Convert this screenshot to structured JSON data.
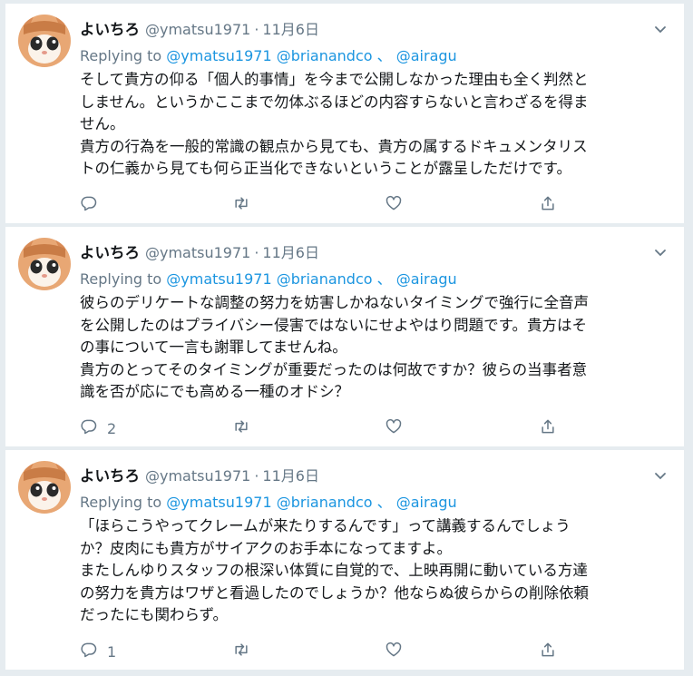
{
  "tweets": [
    {
      "name": "よいちろ",
      "handle": "@ymatsu1971",
      "date": "11月6日",
      "replying_prefix": "Replying to",
      "mention1": "@ymatsu1971",
      "mention2": "@brianandco",
      "separator": "、",
      "mention3": "@airagu",
      "lines": [
        "そして貴方の仰る「個人的事情」を今まで公開しなかった理由も全く判然と",
        "しません。というかここまで勿体ぶるほどの内容すらないと言わざるを得ま",
        "せん。",
        "貴方の行為を一般的常識の観点から見ても、貴方の属するドキュメンタリス",
        "トの仁義から見ても何ら正当化できないということが露呈しただけです。"
      ],
      "reply_count": ""
    },
    {
      "name": "よいちろ",
      "handle": "@ymatsu1971",
      "date": "11月6日",
      "replying_prefix": "Replying to",
      "mention1": "@ymatsu1971",
      "mention2": "@brianandco",
      "separator": "、",
      "mention3": "@airagu",
      "lines": [
        "彼らのデリケートな調整の努力を妨害しかねないタイミングで強行に全音声",
        "を公開したのはプライバシー侵害ではないにせよやはり問題です。貴方はそ",
        "の事について一言も謝罪してませんね。",
        "貴方のとってそのタイミングが重要だったのは何故ですか？彼らの当事者意",
        "識を否が応にでも高める一種のオドシ？"
      ],
      "reply_count": "2"
    },
    {
      "name": "よいちろ",
      "handle": "@ymatsu1971",
      "date": "11月6日",
      "replying_prefix": "Replying to",
      "mention1": "@ymatsu1971",
      "mention2": "@brianandco",
      "separator": "、",
      "mention3": "@airagu",
      "lines": [
        "「ほらこうやってクレームが来たりするんです」って講義するんでしょう",
        "か？皮肉にも貴方がサイアクのお手本になってますよ。",
        "またしんゆりスタッフの根深い体質に自覚的で、上映再開に動いている方達",
        "の努力を貴方はワザと看過したのでしょうか？他ならぬ彼らからの削除依頼",
        "だったにも関わらず。"
      ],
      "reply_count": "1"
    }
  ],
  "icons": {
    "reply": "reply-icon",
    "retweet": "retweet-icon",
    "like": "heart-icon",
    "share": "share-icon",
    "menu": "chevron-down-icon"
  },
  "colors": {
    "link": "#1b95e0",
    "secondary": "#657786",
    "text": "#14171a",
    "background": "#e6ecf0"
  }
}
